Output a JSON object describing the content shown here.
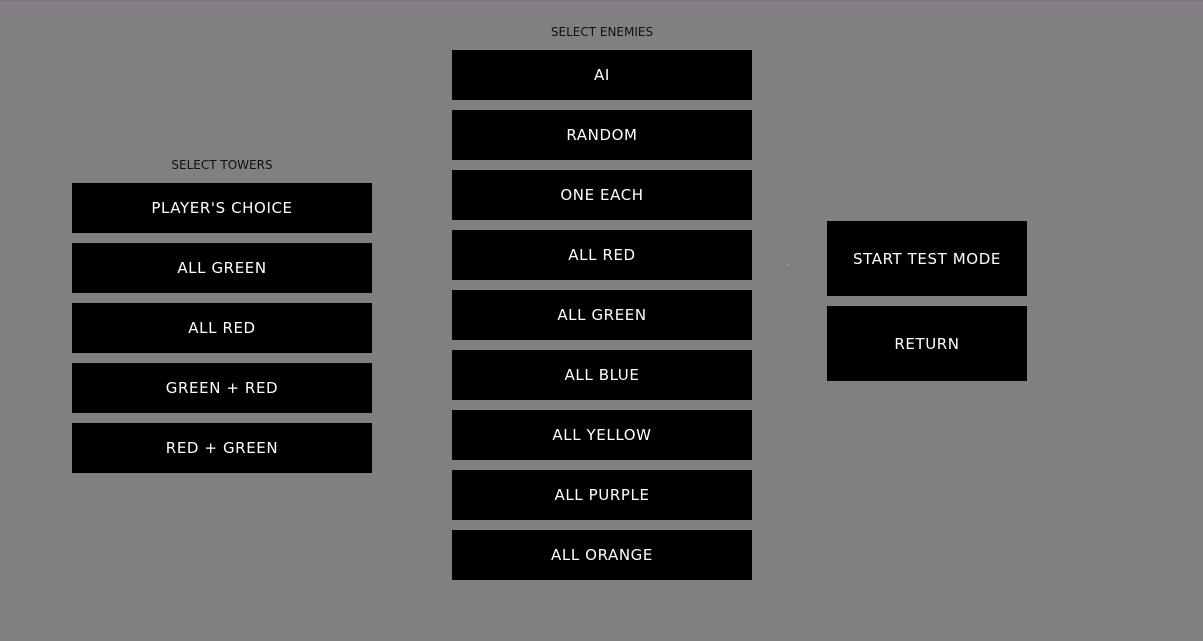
{
  "towers": {
    "title": "SELECT TOWERS",
    "options": [
      "PLAYER'S CHOICE",
      "ALL GREEN",
      "ALL RED",
      "GREEN + RED",
      "RED + GREEN"
    ]
  },
  "enemies": {
    "title": "SELECT ENEMIES",
    "options": [
      "AI",
      "RANDOM",
      "ONE EACH",
      "ALL RED",
      "ALL GREEN",
      "ALL BLUE",
      "ALL YELLOW",
      "ALL PURPLE",
      "ALL ORANGE"
    ]
  },
  "actions": {
    "start_label": "START TEST MODE",
    "return_label": "RETURN"
  },
  "colors": {
    "background": "#808080",
    "button": "#000000",
    "button_text": "#ffffff"
  }
}
